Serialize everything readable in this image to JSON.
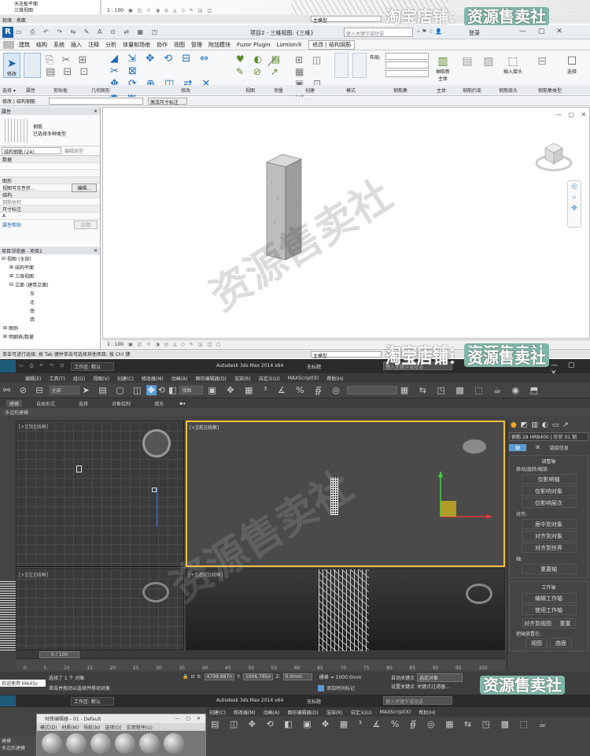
{
  "top_strip": {
    "tree_items": [
      "天花板平面",
      "三维视图"
    ],
    "status_left": "就绪 : 表面",
    "zoom": "1 : 100",
    "model_label": "主模型",
    "shop_prefix": "淘宝店铺：",
    "shop_name": "资源售卖社"
  },
  "revit": {
    "title": "项目2 - 三维视图: {三维}",
    "search_placeholder": "键入关键字或短语",
    "login": "登录",
    "menu": [
      "建筑",
      "结构",
      "系统",
      "插入",
      "注释",
      "分析",
      "体量和场地",
      "协作",
      "视图",
      "管理",
      "附加模块",
      "Fuzor Plugin",
      "Lumion®",
      "修改 | 结构钢筋"
    ],
    "ribbon_groups": [
      "选择 ▾",
      "属性",
      "剪贴板",
      "几何图形",
      "修改",
      "视图",
      "测量",
      "创建",
      "模式",
      "钢筋集",
      "主体",
      "钢筋约束",
      "钢筋接头",
      "钢筋集类型"
    ],
    "ribbon_big_buttons": [
      "修改",
      "编辑约束",
      "抽取新主体",
      "编辑放置",
      "钢筋形状",
      "插入接头",
      "不同长度设置",
      "选择"
    ],
    "layout_label": "布局:",
    "modify_bar": "修改 | 结构钢筋",
    "activate_dimension": "激活尺寸标注",
    "properties": {
      "header": "属性",
      "type_name": "钢筋",
      "type_sub": "已选择多种类型",
      "selector": "结构钢筋 (24)",
      "edit_type": "编辑类型",
      "rows": [
        "数据",
        "图形",
        "视图可见性状...",
        "结构",
        "钢筋体积",
        "尺寸标注",
        "A"
      ],
      "edit_btn": "编辑...",
      "help": "属性帮助",
      "apply": "应用"
    },
    "browser": {
      "header": "项目浏览器 - 项目2",
      "items": [
        "视图 (全部)",
        "结构平面",
        "三维视图",
        "立面 (建筑立面)",
        "东",
        "北",
        "南",
        "西",
        "图例",
        "明细表/数量"
      ]
    },
    "status": "单击可进行选择; 按 Tab 键并单击可选择其他项目; 按 Ctrl 键",
    "zoom": "1 : 100",
    "model_label": "主模型"
  },
  "max": {
    "title": "Autodesk 3ds Max  2014 x64",
    "file": "无标题",
    "workspace": "工作区: 默认",
    "search_placeholder": "键入关键字或短语",
    "menu": [
      "编辑(E)",
      "工具(T)",
      "组(G)",
      "视图(V)",
      "创建(C)",
      "修改器(M)",
      "动画(A)",
      "图形编辑器(D)",
      "渲染(R)",
      "自定义(U)",
      "MAXScript(X)",
      "帮助(H)"
    ],
    "selection_filter": "全部",
    "view_select": "视图",
    "ribbon_tabs": [
      "建模",
      "自由形式",
      "选择",
      "对象绘制",
      "填充"
    ],
    "ribbon_sub": "多边形建模",
    "viewport_labels": [
      "[+][顶][线框]",
      "[+][前][线框]",
      "[+][左][线框]",
      "[+][透视][线框]"
    ],
    "cmd_panel": {
      "object_name": "钢筋 28 HRB400 | 形状 01 钢",
      "tabs": [
        "轴",
        "IK",
        "链接信息"
      ],
      "section_adjust": "调整轴",
      "move_label": "移动/旋转/缩放:",
      "btns_move": [
        "仅影响轴",
        "仅影响对象",
        "仅影响层次"
      ],
      "align_label": "对齐:",
      "btns_align": [
        "居中到对象",
        "对齐到对象",
        "对齐到世界"
      ],
      "axis_label": "轴:",
      "btn_reset": "重置轴",
      "section_work": "工作轴",
      "btns_work": [
        "编辑工作轴",
        "使用工作轴"
      ],
      "btn_align_view": "对齐到视图",
      "btn_reset2": "重置",
      "placement_label": "把轴放置在:",
      "btns_place": [
        "视图",
        "曲面"
      ]
    },
    "timeline": {
      "counter": "0 / 100",
      "ticks": [
        "0",
        "5",
        "10",
        "15",
        "20",
        "25",
        "30",
        "35",
        "40",
        "45",
        "50",
        "55",
        "60",
        "65",
        "70",
        "75",
        "80",
        "85",
        "90",
        "95",
        "100"
      ]
    },
    "status": {
      "selected": "选择了 1 个 对象",
      "hint": "单击并拖动以选择并移动对象",
      "welcome": "欢迎使用 MAXSc",
      "x_label": "X:",
      "x": "4799.687n",
      "y_label": "Y:",
      "y": "1006.765n",
      "z_label": "Z:",
      "z": "0.0mm",
      "grid": "栅格 = 1000.0mm",
      "autokey": "自动关键点",
      "selected_obj": "选定对象",
      "set_key": "设置关键点",
      "key_filter": "关键点过滤器...",
      "add_time_tag": "添加时间标记"
    }
  },
  "bottom": {
    "title": "Autodesk 3ds Max  2014 x64",
    "file": "无标题",
    "workspace": "工作区: 默认",
    "material_editor": "材质编辑器 - 01 - Default",
    "mat_menu": [
      "模式(D)",
      "材质(M)",
      "导航(N)",
      "选项(O)",
      "实用程序(U)"
    ],
    "tabs": [
      "建模",
      "多边形建模"
    ]
  },
  "watermark": "资源售卖社"
}
